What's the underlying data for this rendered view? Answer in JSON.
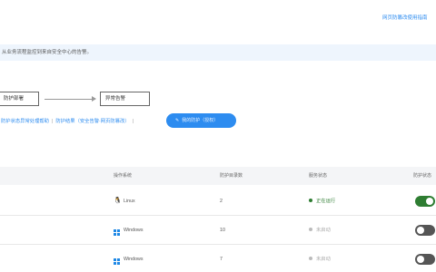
{
  "header": {
    "help_link": "网页防篡改使用指南"
  },
  "banner": {
    "text": "从业务流程监控到来自安全中心的告警。"
  },
  "flow": {
    "step1": "防护部署",
    "step2": "异常告警"
  },
  "actions": {
    "link1": "防护状态异常处理帮助",
    "link2": "防护结果（安全告警·网页防篡改）",
    "button_label": "我的防护（授权）"
  },
  "table": {
    "columns": [
      "操作系统",
      "防护目录数",
      "服务状态",
      "防护状态"
    ],
    "rows": [
      {
        "os": "Linux",
        "os_icon": "linux-icon",
        "dir_count": "2",
        "service_status": "正在运行",
        "status_color": "#2e7d32",
        "protection_on": true
      },
      {
        "os": "Windows",
        "os_icon": "windows-icon",
        "dir_count": "10",
        "service_status": "未启动",
        "status_color": "#bbbbbb",
        "protection_on": false
      },
      {
        "os": "Windows",
        "os_icon": "windows-icon",
        "dir_count": "7",
        "service_status": "未启动",
        "status_color": "#bbbbbb",
        "protection_on": false
      }
    ]
  },
  "colors": {
    "accent": "#2d8cf0",
    "running": "#2e7d32",
    "toggle_on": "#2e7d32",
    "toggle_off": "#555555",
    "banner_bg": "#eef5fd"
  }
}
